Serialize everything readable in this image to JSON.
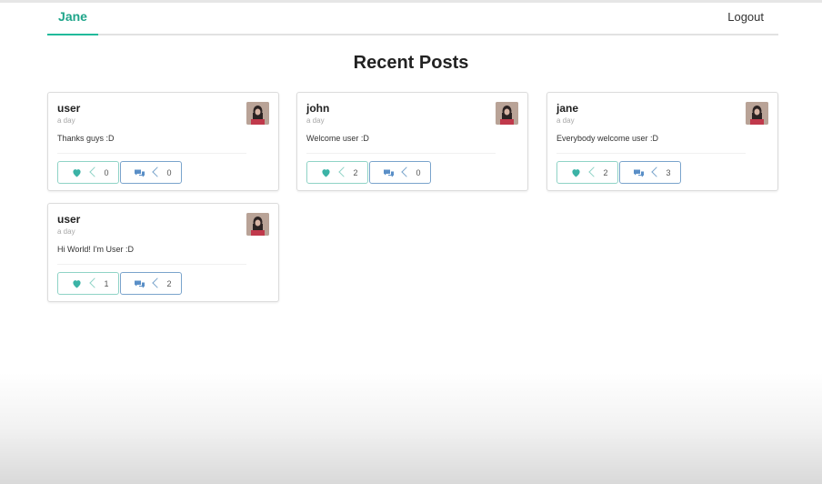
{
  "menu": {
    "home_label": "Jane",
    "logout_label": "Logout"
  },
  "page": {
    "title": "Recent Posts"
  },
  "colors": {
    "accent": "#21ba9b",
    "like_icon": "#3bb3a6",
    "comment_icon": "#5a8fc7"
  },
  "posts": [
    {
      "author": "user",
      "meta": "a day",
      "text": "Thanks guys :D",
      "likes": "0",
      "comments": "0"
    },
    {
      "author": "john",
      "meta": "a day",
      "text": "Welcome user :D",
      "likes": "2",
      "comments": "0"
    },
    {
      "author": "jane",
      "meta": "a day",
      "text": "Everybody welcome user :D",
      "likes": "2",
      "comments": "3"
    },
    {
      "author": "user",
      "meta": "a day",
      "text": "Hi World! I'm User :D",
      "likes": "1",
      "comments": "2"
    }
  ]
}
